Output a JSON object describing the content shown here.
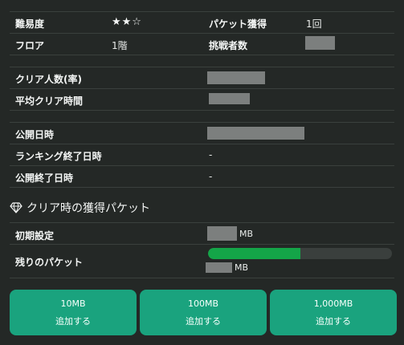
{
  "stats": {
    "difficulty_label": "難易度",
    "difficulty_stars": "★★☆",
    "packet_label": "パケット獲得",
    "packet_value": "1回",
    "floor_label": "フロア",
    "floor_value": "1階",
    "challengers_label": "挑戦者数",
    "clear_rate_label": "クリア人数(率)",
    "avg_time_label": "平均クリア時間",
    "published_label": "公開日時",
    "ranking_end_label": "ランキング終了日時",
    "ranking_end_value": "-",
    "publish_end_label": "公開終了日時",
    "publish_end_value": "-"
  },
  "packet_section": {
    "title": "クリア時の獲得パケット",
    "icon": "gem-icon",
    "initial_label": "初期設定",
    "initial_unit": "MB",
    "remaining_label": "残りのパケット",
    "remaining_unit": "MB",
    "remaining_fraction": 0.5
  },
  "buttons": [
    {
      "amount": "10MB",
      "action": "追加する"
    },
    {
      "amount": "100MB",
      "action": "追加する"
    },
    {
      "amount": "1,000MB",
      "action": "追加する"
    }
  ],
  "colors": {
    "background": "#242826",
    "accent_button": "#1aa37e",
    "progress_fill": "#14a548",
    "redaction": "#7c7f7e"
  }
}
